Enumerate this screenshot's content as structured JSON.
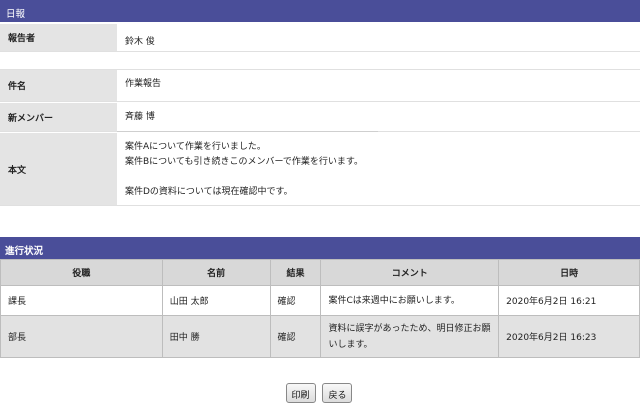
{
  "header": {
    "title": "日報"
  },
  "report": {
    "reporter_label": "報告者",
    "reporter_value": "鈴木 俊",
    "subject_label": "件名",
    "subject_value": "作業報告",
    "member_label": "新メンバー",
    "member_value": "斉藤 博",
    "body_label": "本文",
    "body_lines": [
      "案件Aについて作業を行いました。",
      "案件Bについても引き続きこのメンバーで作業を行います。",
      "",
      "案件Dの資料については現在確認中です。"
    ]
  },
  "progress": {
    "title": "進行状況",
    "columns": [
      "役職",
      "名前",
      "結果",
      "コメント",
      "日時"
    ],
    "rows": [
      {
        "role": "課長",
        "name": "山田 太郎",
        "result": "確認",
        "comment": "案件Cは来週中にお願いします。",
        "datetime": "2020年6月2日 16:21"
      },
      {
        "role": "部長",
        "name": "田中 勝",
        "result": "確認",
        "comment": "資料に誤字があったため、明日修正お願いします。",
        "datetime": "2020年6月2日 16:23"
      }
    ]
  },
  "buttons": {
    "print_label": "印刷",
    "back_label": "戻る"
  }
}
